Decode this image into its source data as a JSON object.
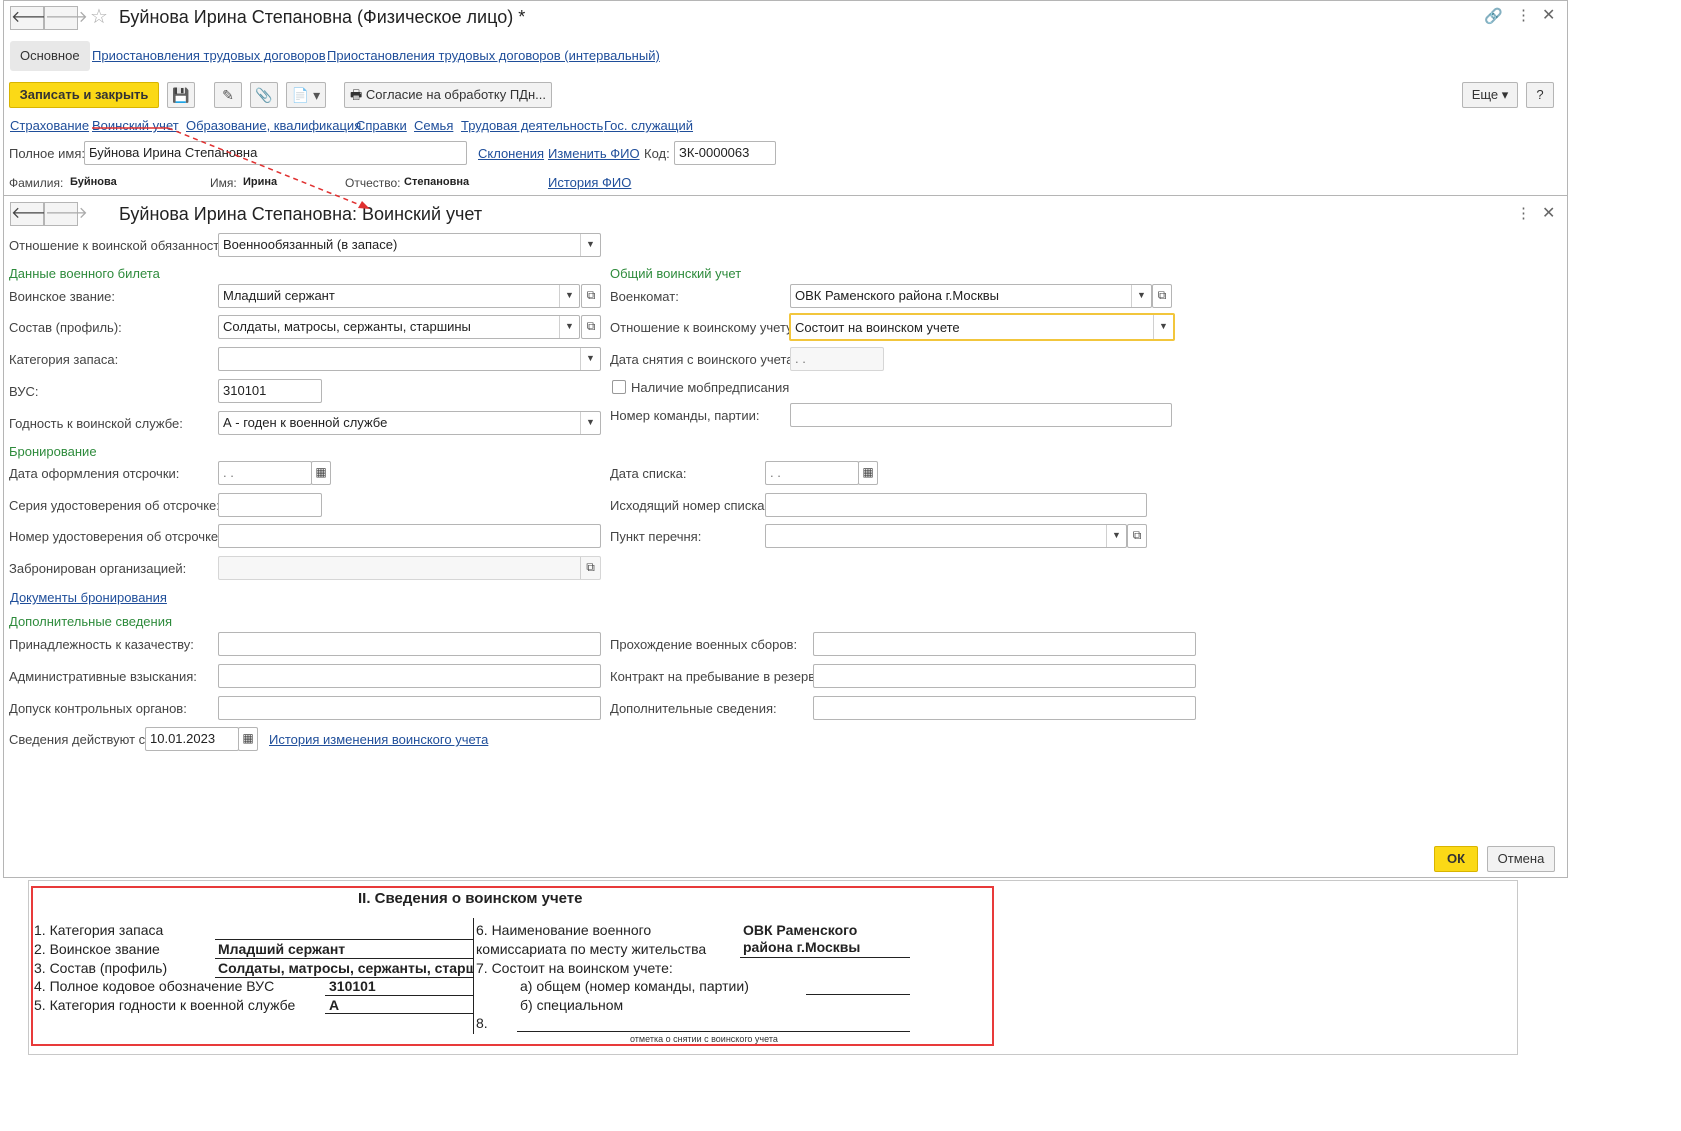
{
  "main_window": {
    "title": "Буйнова Ирина Степановна (Физическое лицо) *",
    "tabs": [
      "Основное",
      "Приостановления трудовых договоров",
      "Приостановления трудовых договоров (интервальный)"
    ],
    "toolbar": {
      "save_close": "Записать и закрыть",
      "consent": "Согласие на обработку ПДн...",
      "more": "Еще",
      "help": "?"
    },
    "links": [
      "Страхование",
      "Воинский учет",
      "Образование, квалификация",
      "Справки",
      "Семья",
      "Трудовая деятельность",
      "Гос. служащий"
    ],
    "full_name_label": "Полное имя:",
    "full_name_value": "Буйнова Ирина Степановна",
    "declension_link": "Склонения",
    "change_fio_link": "Изменить ФИО",
    "code_label": "Код:",
    "code_value": "ЗК-0000063",
    "surname_label": "Фамилия:",
    "surname_value": "Буйнова",
    "name_label": "Имя:",
    "name_value": "Ирина",
    "patronymic_label": "Отчество:",
    "patronymic_value": "Степановна",
    "history_fio_link": "История ФИО"
  },
  "military_window": {
    "title": "Буйнова Ирина Степановна: Воинский учет",
    "obligation_label": "Отношение к воинской обязанности:",
    "obligation_value": "Военнообязанный (в запасе)",
    "section_ticket": "Данные военного билета",
    "rank_label": "Воинское звание:",
    "rank_value": "Младший сержант",
    "profile_label": "Состав (профиль):",
    "profile_value": "Солдаты, матросы, сержанты, старшины",
    "reserve_cat_label": "Категория запаса:",
    "reserve_cat_value": "",
    "vus_label": "ВУС:",
    "vus_value": "310101",
    "fitness_label": "Годность к воинской службе:",
    "fitness_value": "А - годен к военной службе",
    "section_general": "Общий воинский учет",
    "commissariat_label": "Военкомат:",
    "commissariat_value": "ОВК Раменского района г.Москвы",
    "registration_label": "Отношение к воинскому учету:",
    "registration_value": "Состоит на воинском учете",
    "deregistration_label": "Дата снятия с воинского учета:",
    "deregistration_value": " .  .",
    "mob_label": "Наличие мобпредписания",
    "team_label": "Номер команды, партии:",
    "section_booking": "Бронирование",
    "deferral_date_label": "Дата оформления отсрочки:",
    "deferral_date_value": " .  .",
    "deferral_series_label": "Серия удостоверения об отсрочке:",
    "deferral_number_label": "Номер удостоверения об отсрочке:",
    "reserved_by_label": "Забронирован организацией:",
    "list_date_label": "Дата списка:",
    "list_date_value": " .  .",
    "list_number_label": "Исходящий номер списка:",
    "list_item_label": "Пункт перечня:",
    "booking_docs_link": "Документы бронирования",
    "section_extra": "Дополнительные сведения",
    "cossack_label": "Принадлежность к казачеству:",
    "admin_label": "Административные взыскания:",
    "access_label": "Допуск контрольных органов:",
    "training_label": "Прохождение военных сборов:",
    "contract_label": "Контракт на пребывание в резерве:",
    "extra_label": "Дополнительные сведения:",
    "effective_label": "Сведения действуют с:",
    "effective_value": "10.01.2023",
    "history_link": "История изменения воинского учета",
    "ok": "ОК",
    "cancel": "Отмена"
  },
  "paper": {
    "heading": "II. Сведения о воинском учете",
    "l1": "1. Категория запаса",
    "l2": "2. Воинское звание",
    "l2v": "Младший сержант",
    "l3": "3. Состав (профиль)",
    "l3v": "Солдаты, матросы, сержанты, старши",
    "l4": "4. Полное кодовое обозначение ВУС",
    "l4v": "310101",
    "l5": "5. Категория годности к военной службе",
    "l5v": "А",
    "r6a": "6. Наименование военного",
    "r6b": "комиссариата по месту жительства",
    "r6v1": "ОВК Раменского",
    "r6v2": "района г.Москвы",
    "r7": "7. Состоит на воинском учете:",
    "r7a": "а) общем (номер команды, партии)",
    "r7b": "б) специальном",
    "r8": "8.",
    "r8note": "отметка о снятии с воинского учета"
  }
}
